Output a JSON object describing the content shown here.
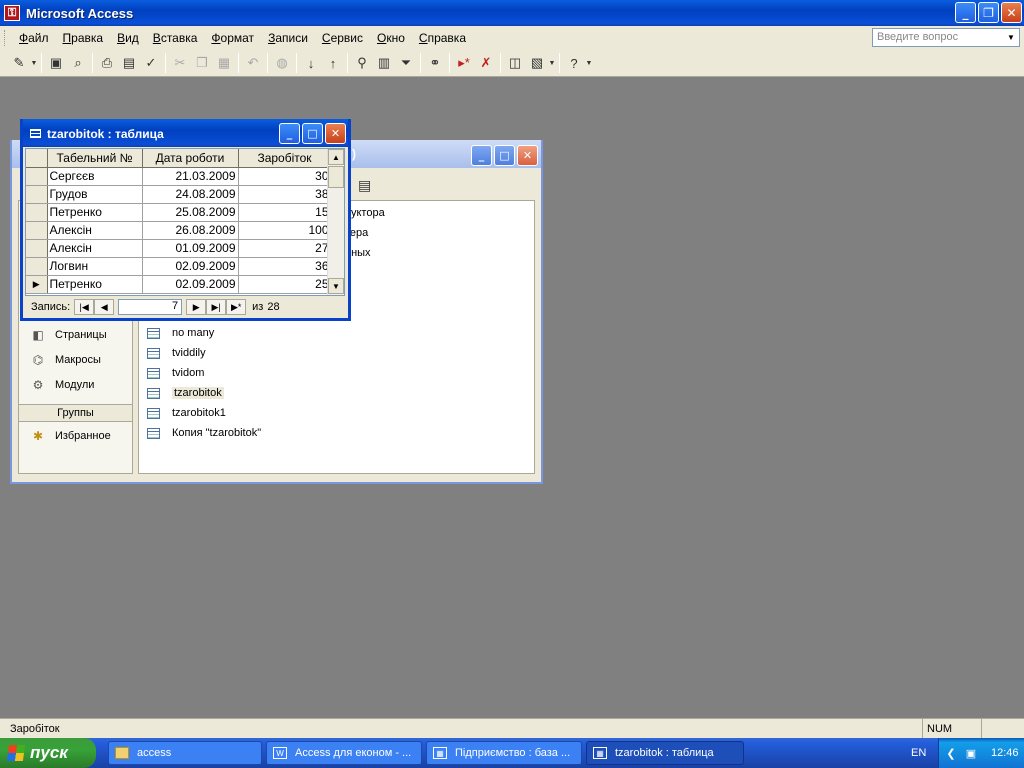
{
  "app": {
    "title": "Microsoft Access"
  },
  "menu": [
    "Файл",
    "Правка",
    "Вид",
    "Вставка",
    "Формат",
    "Записи",
    "Сервис",
    "Окно",
    "Справка"
  ],
  "help_box": {
    "placeholder": "Введите вопрос"
  },
  "db_window": {
    "title": ")",
    "objects": [
      {
        "label": "Страницы",
        "icon": "page-icon"
      },
      {
        "label": "Макросы",
        "icon": "macro-icon"
      },
      {
        "label": "Модули",
        "icon": "module-icon"
      }
    ],
    "groups_label": "Группы",
    "favorites_label": "Избранное",
    "partial_rows": [
      "руктора",
      "тера",
      "нных"
    ],
    "list": [
      "no many",
      "tviddily",
      "tvidom",
      "tzarobitok",
      "tzarobitok1",
      "Копия \"tzarobitok\""
    ],
    "selected_item": "tzarobitok"
  },
  "table_window": {
    "title": "tzarobitok : таблица",
    "columns": [
      "Табельний №",
      "Дата роботи",
      "Заробіток"
    ],
    "rows": [
      [
        "Сергєєв",
        "21.03.2009",
        "30"
      ],
      [
        "Грудов",
        "24.08.2009",
        "38"
      ],
      [
        "Петренко",
        "25.08.2009",
        "15"
      ],
      [
        "Алексін",
        "26.08.2009",
        "100"
      ],
      [
        "Алексін",
        "01.09.2009",
        "27"
      ],
      [
        "Логвин",
        "02.09.2009",
        "36"
      ],
      [
        "Петренко",
        "02.09.2009",
        "25"
      ]
    ],
    "current_row": 7,
    "nav": {
      "label": "Запись:",
      "current": "7",
      "of_label": "из",
      "total": "28"
    }
  },
  "status": {
    "text": "Заробіток",
    "num": "NUM"
  },
  "taskbar": {
    "start": "пуск",
    "tasks": [
      "access",
      "Access для економ - ...",
      "Підприємство : база ...",
      "tzarobitok : таблица"
    ],
    "lang": "EN",
    "clock": "12:46"
  }
}
